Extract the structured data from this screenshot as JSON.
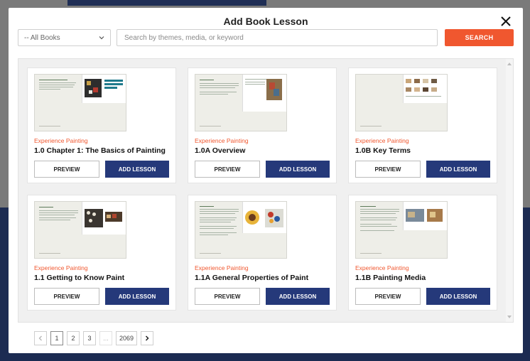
{
  "modal": {
    "title": "Add Book Lesson"
  },
  "filter": {
    "books_value": "-- All Books",
    "search_placeholder": "Search by themes, media, or keyword",
    "search_label": "SEARCH"
  },
  "cards": [
    {
      "category": "Experience Painting",
      "title": "1.0 Chapter 1: The Basics of Painting",
      "preview_label": "PREVIEW",
      "add_label": "ADD LESSON"
    },
    {
      "category": "Experience Painting",
      "title": "1.0A Overview",
      "preview_label": "PREVIEW",
      "add_label": "ADD LESSON"
    },
    {
      "category": "Experience Painting",
      "title": "1.0B Key Terms",
      "preview_label": "PREVIEW",
      "add_label": "ADD LESSON"
    },
    {
      "category": "Experience Painting",
      "title": "1.1 Getting to Know Paint",
      "preview_label": "PREVIEW",
      "add_label": "ADD LESSON"
    },
    {
      "category": "Experience Painting",
      "title": "1.1A General Properties of Paint",
      "preview_label": "PREVIEW",
      "add_label": "ADD LESSON"
    },
    {
      "category": "Experience Painting",
      "title": "1.1B Painting Media",
      "preview_label": "PREVIEW",
      "add_label": "ADD LESSON"
    }
  ],
  "pagination": {
    "pages": [
      "1",
      "2",
      "3",
      "...",
      "2069"
    ],
    "current": "1"
  },
  "colors": {
    "accent": "#f0572f",
    "primary": "#25397a"
  }
}
